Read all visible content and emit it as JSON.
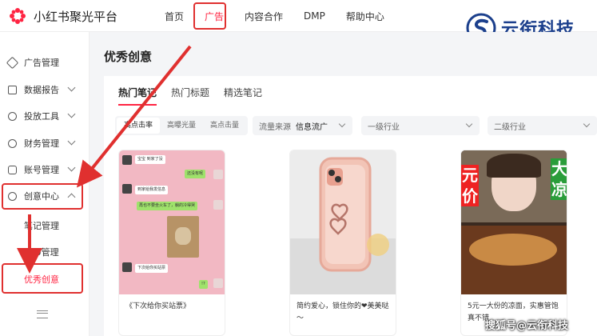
{
  "app": {
    "name": "小红书聚光平台"
  },
  "nav": {
    "items": [
      "首页",
      "广告",
      "内容合作",
      "DMP",
      "帮助中心"
    ]
  },
  "brand": {
    "name": "云衔科技"
  },
  "sidebar": {
    "items": [
      {
        "label": "广告管理",
        "icon": "tag-icon"
      },
      {
        "label": "数据报告",
        "icon": "report-icon"
      },
      {
        "label": "投放工具",
        "icon": "wrench-icon"
      },
      {
        "label": "财务管理",
        "icon": "yen-icon"
      },
      {
        "label": "账号管理",
        "icon": "account-icon"
      },
      {
        "label": "创意中心",
        "icon": "palette-icon"
      }
    ],
    "sub": [
      "笔记管理",
      "SPU管理",
      "优秀创意"
    ]
  },
  "page": {
    "title": "优秀创意"
  },
  "tabs": [
    "热门笔记",
    "热门标题",
    "精选笔记"
  ],
  "segment": [
    "高点击率",
    "高曝光量",
    "高点击量"
  ],
  "filters": {
    "source_label": "流量来源",
    "source_value": "信息流广",
    "industry1": "一级行业",
    "industry2": "二级行业"
  },
  "posts": [
    {
      "caption": "《下次给你买站票》",
      "chat": [
        "宝宝 到家了没",
        "还没有呢",
        "到家给我发信息",
        "再也不要坐火车了，躺的冷得哭",
        "下次给你买站票",
        "!?"
      ]
    },
    {
      "caption": "简约爱心，锁住你的❤美美哒～"
    },
    {
      "caption": "5元一大份的凉面，实惠管饱真不错",
      "overlay": [
        "元价",
        "大凉"
      ]
    }
  ],
  "watermark": "搜狐号@云衔科技"
}
